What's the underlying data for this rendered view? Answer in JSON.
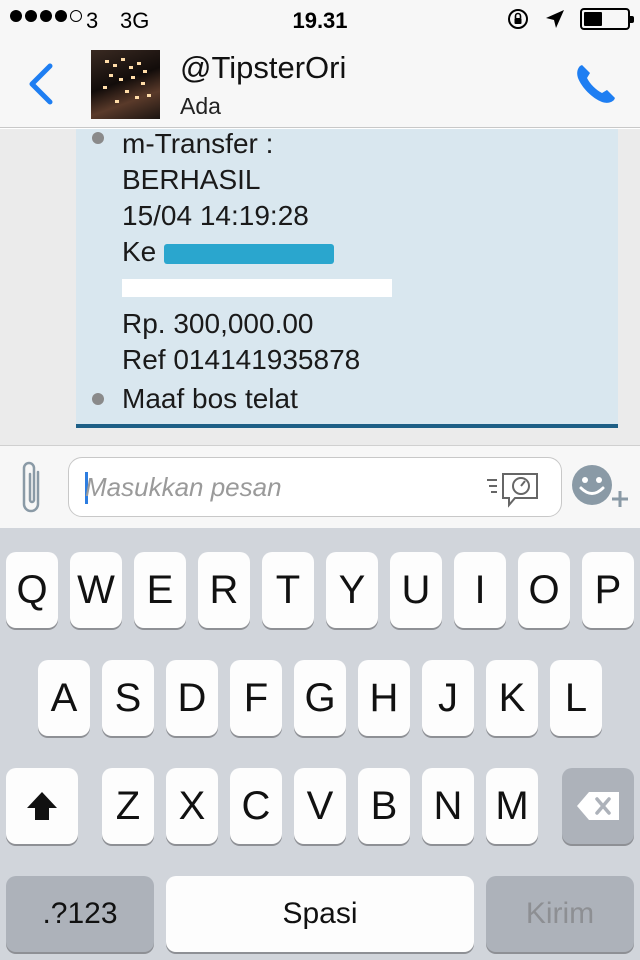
{
  "status_bar": {
    "carrier": "3",
    "network": "3G",
    "time": "19.31",
    "battery_level": 0.4
  },
  "header": {
    "back_icon": "chevron-left-icon",
    "contact_name": "@TipsterOri",
    "contact_status": "Ada",
    "call_icon": "phone-icon"
  },
  "chat": {
    "messages": [
      {
        "lines": [
          "m-Transfer :",
          "BERHASIL",
          "15/04 14:19:28",
          "Ke",
          "Rp. 300,000.00",
          "Ref 014141935878"
        ]
      },
      {
        "text": "Maaf bos telat"
      }
    ]
  },
  "input_bar": {
    "placeholder": "Masukkan pesan"
  },
  "keyboard": {
    "row1": [
      "Q",
      "W",
      "E",
      "R",
      "T",
      "Y",
      "U",
      "I",
      "O",
      "P"
    ],
    "row2": [
      "A",
      "S",
      "D",
      "F",
      "G",
      "H",
      "J",
      "K",
      "L"
    ],
    "row3": [
      "Z",
      "X",
      "C",
      "V",
      "B",
      "N",
      "M"
    ],
    "numbers_label": ".?123",
    "space_label": "Spasi",
    "send_label": "Kirim"
  },
  "colors": {
    "accent": "#1e7ef2",
    "bubble": "#d9e7ef",
    "bubble_border": "#1d5f86"
  }
}
